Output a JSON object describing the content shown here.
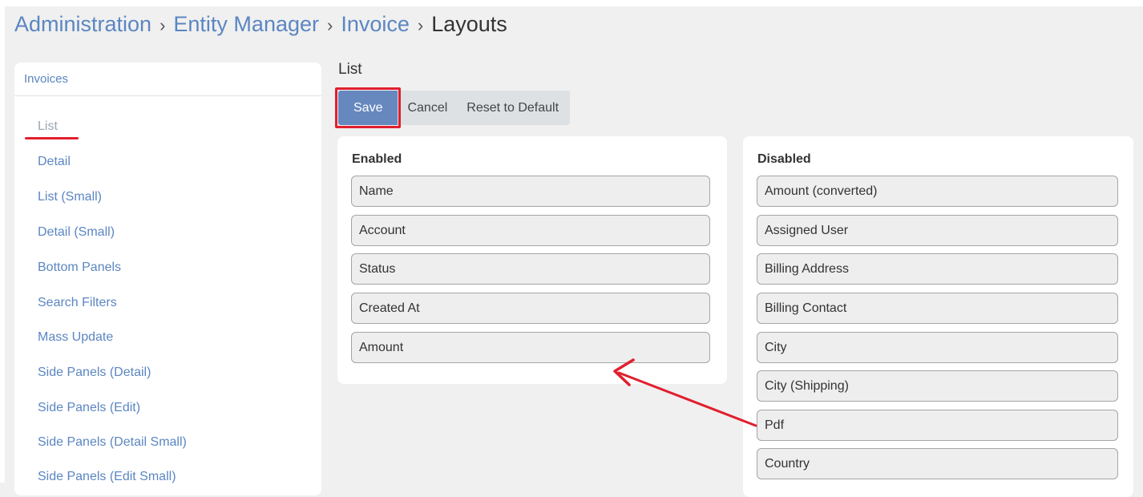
{
  "breadcrumb": {
    "items": [
      "Administration",
      "Entity Manager",
      "Invoice"
    ],
    "separator": "›",
    "current": "Layouts"
  },
  "sidebar": {
    "header": "Invoices",
    "items": [
      {
        "label": "List",
        "active": true
      },
      {
        "label": "Detail"
      },
      {
        "label": "List (Small)"
      },
      {
        "label": "Detail (Small)"
      },
      {
        "label": "Bottom Panels"
      },
      {
        "label": "Search Filters"
      },
      {
        "label": "Mass Update"
      },
      {
        "label": "Side Panels (Detail)"
      },
      {
        "label": "Side Panels (Edit)"
      },
      {
        "label": "Side Panels (Detail Small)"
      },
      {
        "label": "Side Panels (Edit Small)"
      }
    ]
  },
  "main": {
    "title": "List",
    "buttons": {
      "save": "Save",
      "cancel": "Cancel",
      "reset": "Reset to Default"
    },
    "enabled": {
      "title": "Enabled",
      "fields": [
        "Name",
        "Account",
        "Status",
        "Created At",
        "Amount"
      ]
    },
    "disabled": {
      "title": "Disabled",
      "fields": [
        "Amount (converted)",
        "Assigned User",
        "Billing Address",
        "Billing Contact",
        "City",
        "City (Shipping)",
        "Pdf",
        "Country"
      ]
    }
  },
  "colors": {
    "link": "#5b86c2",
    "primary_button": "#6688be",
    "annotation_red": "#e11f2e"
  }
}
